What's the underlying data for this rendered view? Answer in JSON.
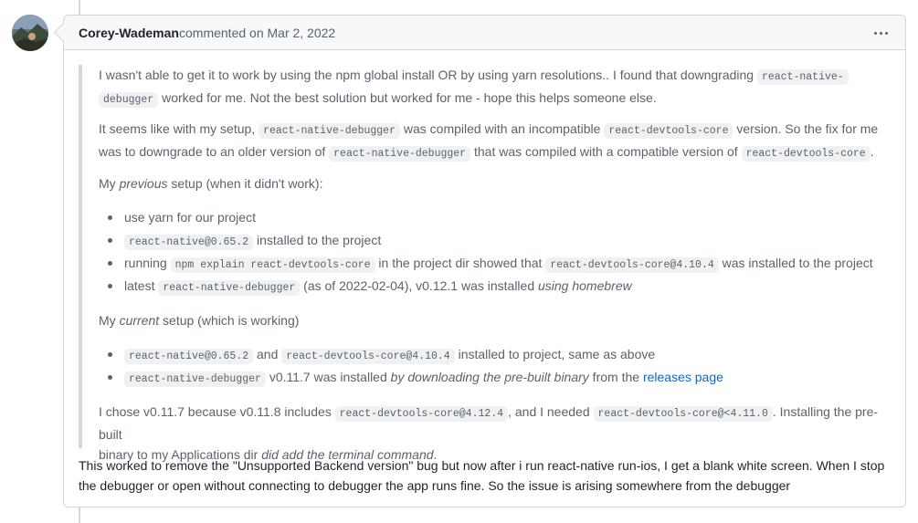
{
  "comment": {
    "author": "Corey-Wademan",
    "action": "commented on Mar 2, 2022",
    "menu_icon": "kebab-horizontal-icon"
  },
  "quote": {
    "p1": {
      "a": "I wasn't able to get it to work by using the npm global install OR by using yarn resolutions.. I found that downgrading ",
      "code1": "react-native-",
      "code2": "debugger",
      "b": " worked for me. Not the best solution but worked for me - hope this helps someone else."
    },
    "p2": {
      "a": "It seems like with my setup, ",
      "code1": "react-native-debugger",
      "b": " was compiled with an incompatible ",
      "code2": "react-devtools-core",
      "c": " version. So the fix for me",
      "d": "was to downgrade to an older version of ",
      "code3": "react-native-debugger",
      "e": " that was compiled with a compatible version of ",
      "code4": "react-devtools-core",
      "f": "."
    },
    "prev_heading": {
      "a": "My ",
      "em": "previous",
      "b": " setup (when it didn't work):"
    },
    "prev_items": {
      "i1": "use yarn for our project",
      "i2_code": "react-native@0.65.2",
      "i2_text": " installed to the project",
      "i3_a": "running ",
      "i3_code1": "npm explain react-devtools-core",
      "i3_b": " in the project dir showed that ",
      "i3_code2": "react-devtools-core@4.10.4",
      "i3_c": " was installed to the project",
      "i4_a": "latest ",
      "i4_code": "react-native-debugger",
      "i4_b": " (as of 2022-02-04), v0.12.1 was installed ",
      "i4_em": "using homebrew"
    },
    "curr_heading": {
      "a": "My ",
      "em": "current",
      "b": " setup (which is working)"
    },
    "curr_items": {
      "i1_code1": "react-native@0.65.2",
      "i1_a": " and ",
      "i1_code2": "react-devtools-core@4.10.4",
      "i1_b": " installed to project, same as above",
      "i2_code": "react-native-debugger",
      "i2_a": " v0.11.7 was installed ",
      "i2_em": "by downloading the pre-built binary",
      "i2_b": " from the ",
      "i2_link": "releases page"
    },
    "p_last": {
      "a": "I chose v0.11.7 because v0.11.8 includes ",
      "code1": "react-devtools-core@4.12.4",
      "b": ", and I needed ",
      "code2": "react-devtools-core@<4.11.0",
      "c": ". Installing the pre-built",
      "d": "binary to my Applications dir ",
      "em": "did add the terminal command",
      "e": "."
    }
  },
  "final": {
    "line1": "This worked to remove the \"Unsupported Backend version\" bug but now after i run react-native run-ios, I get a blank white screen. When I stop",
    "line2": "the debugger or open without connecting to debugger the app runs fine. So the issue is arising somewhere from the debugger"
  },
  "colors": {
    "link": "#0969da",
    "border": "#d0d7de",
    "muted": "#59636e",
    "header_bg": "#f6f8fa"
  }
}
